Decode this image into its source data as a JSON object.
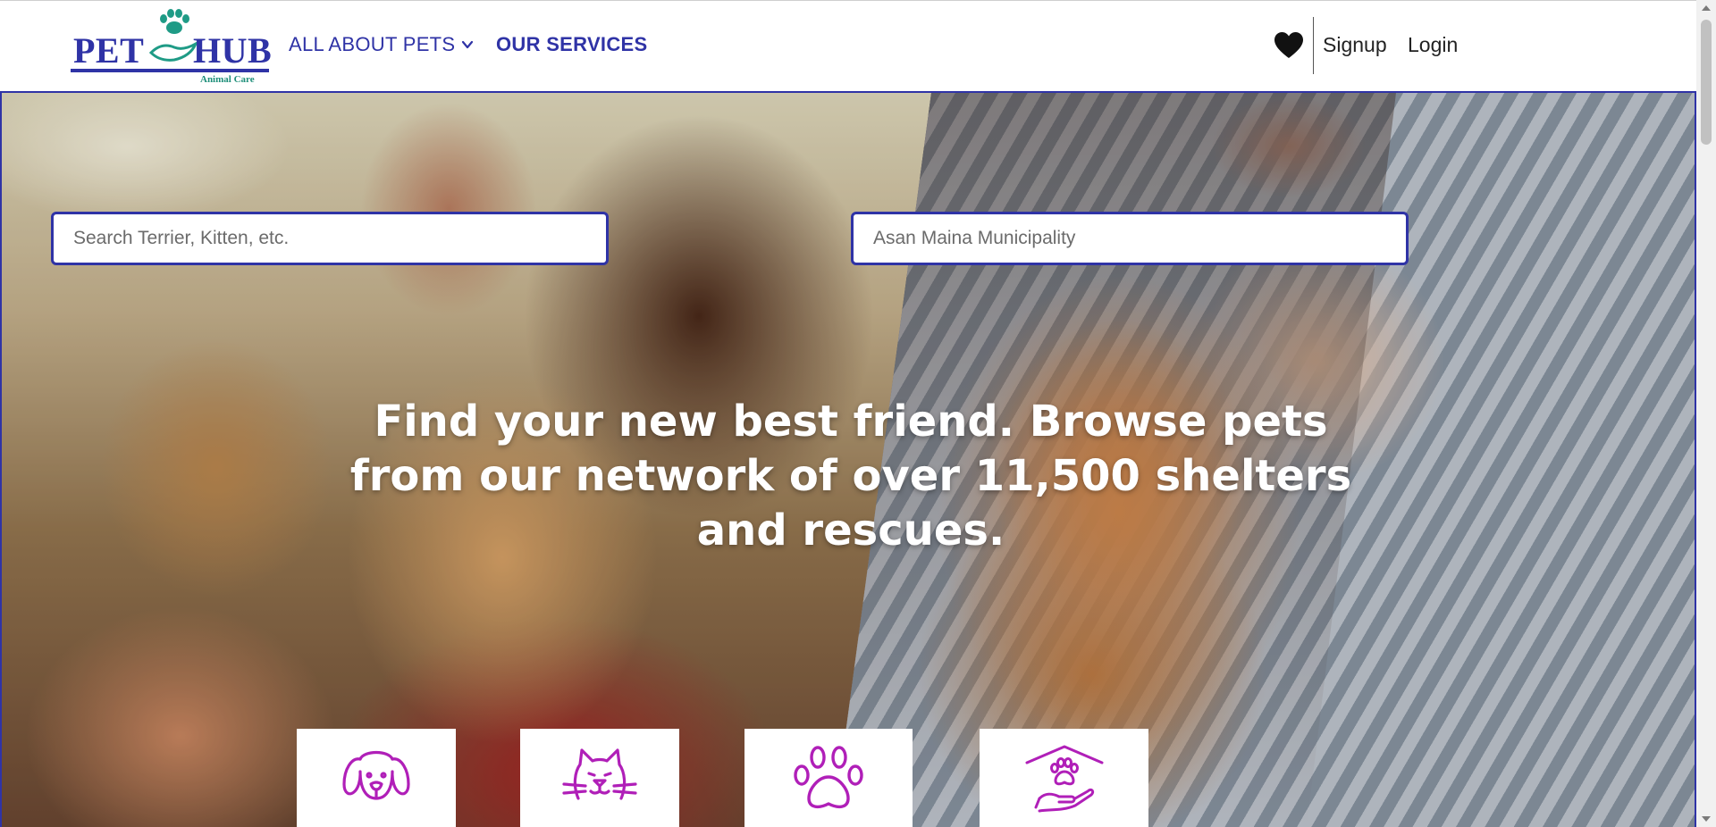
{
  "header": {
    "logo": {
      "word_left": "PET",
      "word_right": "HUB",
      "tagline": "Animal Care",
      "icon": "hand-paw-logo-icon"
    },
    "nav": [
      {
        "label": "ALL ABOUT PETS",
        "has_dropdown": true
      },
      {
        "label": "OUR SERVICES",
        "has_dropdown": false
      }
    ],
    "favorites_icon": "heart-icon",
    "auth": {
      "signup_label": "Signup",
      "login_label": "Login"
    }
  },
  "hero": {
    "search": {
      "pet_placeholder": "Search Terrier, Kitten, etc.",
      "location_placeholder": "Asan Maina Municipality"
    },
    "title": "Find your new best friend. Browse pets from our network of over 11,500 shelters and rescues.",
    "categories": [
      {
        "icon": "dog-icon"
      },
      {
        "icon": "cat-icon"
      },
      {
        "icon": "paw-icon"
      },
      {
        "icon": "shelter-icon"
      }
    ]
  },
  "colors": {
    "brand": "#2f33a6",
    "accent_icon": "#b01fb8",
    "logo_green": "#1f8f7a"
  }
}
